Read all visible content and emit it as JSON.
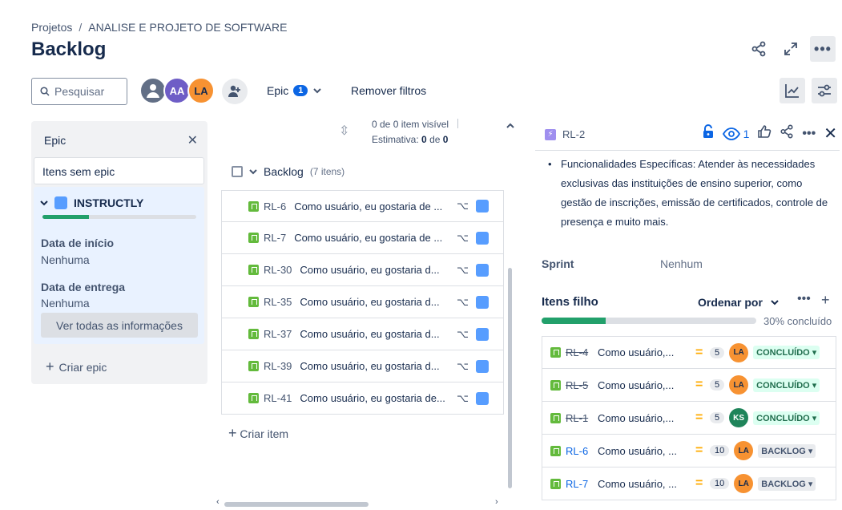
{
  "breadcrumb": {
    "projects": "Projetos",
    "separator": "/",
    "project": "ANALISE E PROJETO DE SOFTWARE"
  },
  "page_title": "Backlog",
  "search": {
    "placeholder": "Pesquisar"
  },
  "avatars": [
    {
      "initials": ""
    },
    {
      "initials": "AA"
    },
    {
      "initials": "LA"
    }
  ],
  "filters": {
    "epic_label": "Epic",
    "epic_count": "1",
    "remove_filters": "Remover filtros"
  },
  "epic_panel": {
    "title": "Epic",
    "no_epic": "Itens sem epic",
    "epic": {
      "name": "INSTRUCTLY",
      "progress": 0.3
    },
    "start_label": "Data de início",
    "start_value": "Nenhuma",
    "due_label": "Data de entrega",
    "due_value": "Nenhuma",
    "view_all": "Ver todas as informações",
    "create_epic": "Criar epic"
  },
  "backlog": {
    "visible_line": "0 de 0 item visível",
    "estimate_label": "Estimativa:",
    "estimate_value": "0",
    "estimate_of": "de",
    "estimate_total": "0",
    "title": "Backlog",
    "count": "(7 itens)",
    "items": [
      {
        "key": "RL-6",
        "summary": "Como usuário, eu gostaria de ..."
      },
      {
        "key": "RL-7",
        "summary": "Como usuário, eu gostaria de ..."
      },
      {
        "key": "RL-30",
        "summary": "Como usuário, eu gostaria d..."
      },
      {
        "key": "RL-35",
        "summary": "Como usuário, eu gostaria d..."
      },
      {
        "key": "RL-37",
        "summary": "Como usuário, eu gostaria d..."
      },
      {
        "key": "RL-39",
        "summary": "Como usuário, eu gostaria d..."
      },
      {
        "key": "RL-41",
        "summary": "Como usuário, eu gostaria de..."
      }
    ],
    "create_item": "Criar item"
  },
  "detail": {
    "key": "RL-2",
    "watchers": "1",
    "description": "Funcionalidades Específicas: Atender às necessidades exclusivas das instituições de ensino superior, como gestão de inscrições, emissão de certificados, controle de presença e muito mais.",
    "sprint_label": "Sprint",
    "sprint_value": "Nenhum",
    "children_title": "Itens filho",
    "order_by": "Ordenar por",
    "progress": 0.3,
    "progress_label": "30% concluído",
    "children": [
      {
        "key": "RL-4",
        "summary": "Como usuário,...",
        "points": "5",
        "assignee": "LA",
        "status": "CONCLUÍDO",
        "done": true
      },
      {
        "key": "RL-5",
        "summary": "Como usuário,...",
        "points": "5",
        "assignee": "LA",
        "status": "CONCLUÍDO",
        "done": true
      },
      {
        "key": "RL-1",
        "summary": "Como usuário,...",
        "points": "5",
        "assignee": "KS",
        "status": "CONCLUÍDO",
        "done": true
      },
      {
        "key": "RL-6",
        "summary": "Como usuário, ...",
        "points": "10",
        "assignee": "LA",
        "status": "BACKLOG",
        "done": false
      },
      {
        "key": "RL-7",
        "summary": "Como usuário, ...",
        "points": "10",
        "assignee": "LA",
        "status": "BACKLOG",
        "done": false
      }
    ]
  },
  "colors": {
    "accent": "#0c66e4",
    "done": "#22a06b",
    "epic": "#579dff",
    "story": "#63ba3c"
  }
}
